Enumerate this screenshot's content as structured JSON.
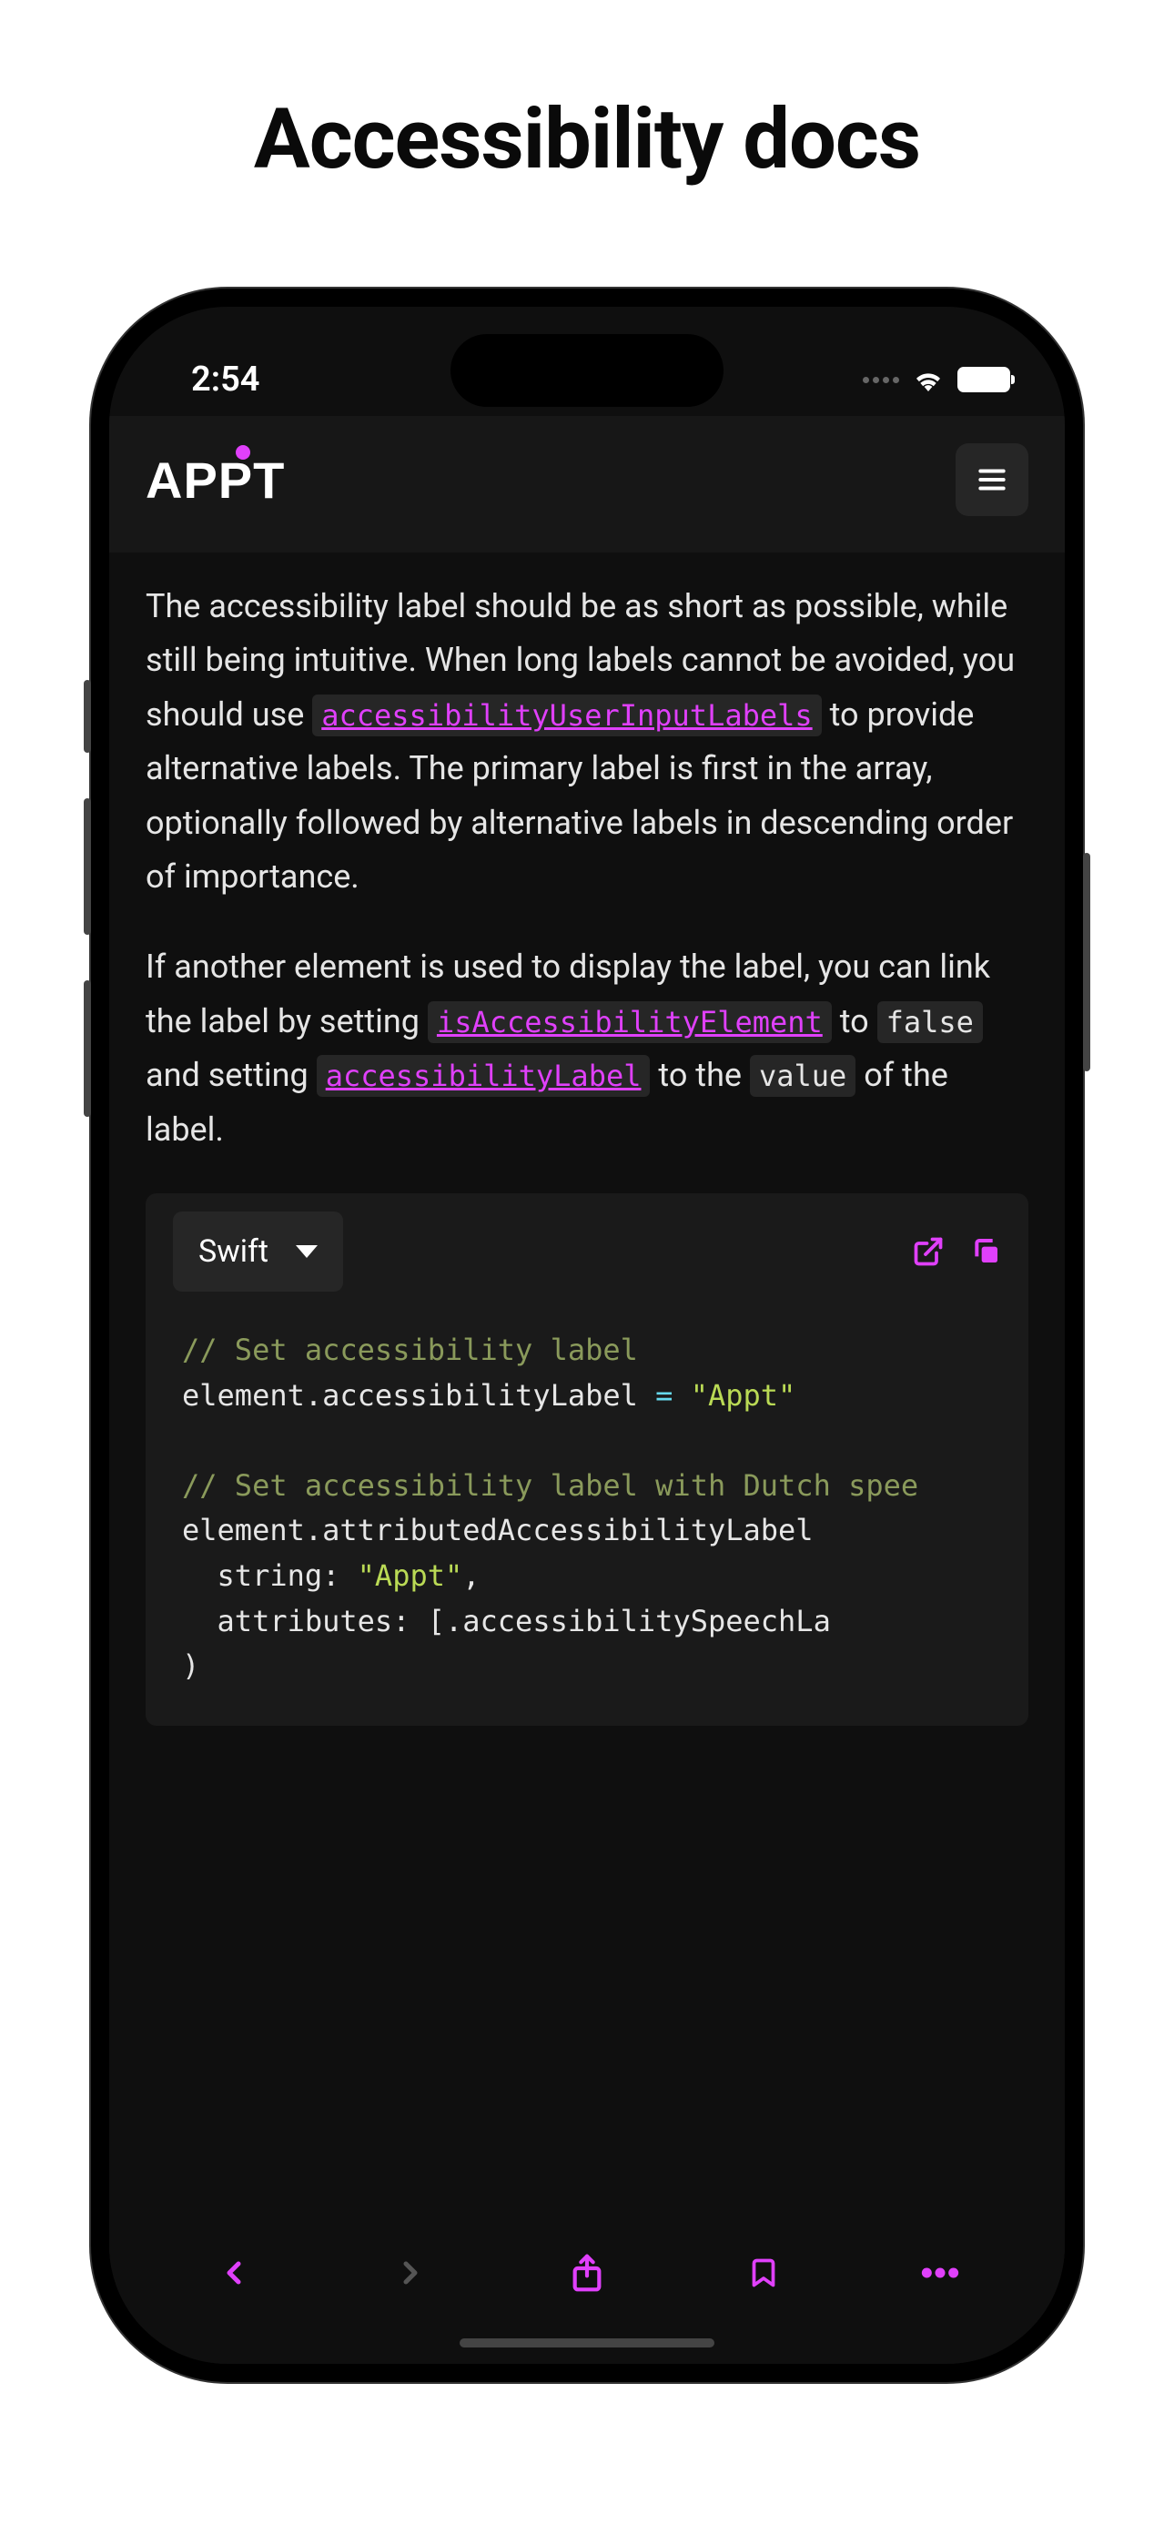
{
  "outer_title": "Accessibility docs",
  "status": {
    "time": "2:54"
  },
  "header": {
    "logo_text": "APPT"
  },
  "content": {
    "p1_a": "The accessibility label should be as short as possible, while still being intuitive. When long labels cannot be avoided, you should use ",
    "p1_code1": "accessibilityUserInputLabels",
    "p1_b": " to provide alternative labels. The primary label is first in the array, optionally followed by alternative labels in descending order of importance.",
    "p2_a": "If another element is used to display the label, you can link the label by setting ",
    "p2_code1": "isAccessibilityElement",
    "p2_b": " to ",
    "p2_code2": "false",
    "p2_c": " and setting ",
    "p2_code3": "accessibilityLabel",
    "p2_d": " to the ",
    "p2_code4": "value",
    "p2_e": " of the label."
  },
  "code": {
    "language": "Swift",
    "c1": "// Set accessibility label",
    "l1a": "element.accessibilityLabel ",
    "l1op": "=",
    "l1b": " ",
    "l1str": "\"Appt\"",
    "c2": "// Set accessibility label with Dutch spee",
    "l2": "element.attributedAccessibilityLabel",
    "l3a": "  string: ",
    "l3str": "\"Appt\"",
    "l3b": ",",
    "l4": "  attributes: [.accessibilitySpeechLa",
    "l5": ")"
  }
}
